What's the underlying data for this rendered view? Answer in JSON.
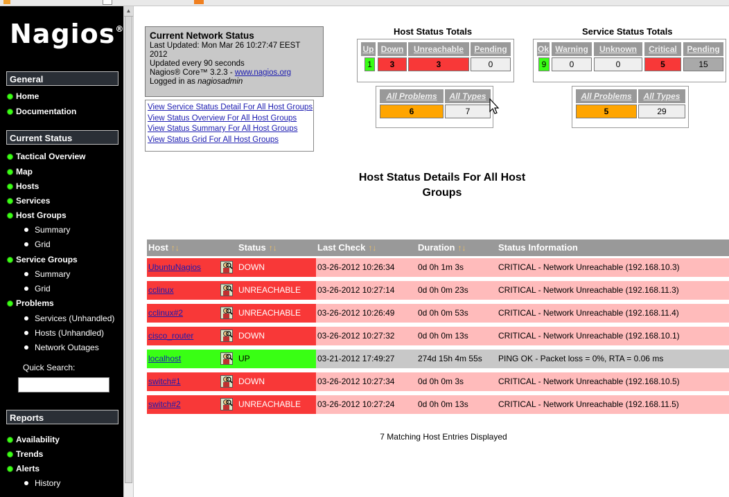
{
  "sidebar": {
    "logo": "Nagios",
    "logo_mark": "®",
    "sections": {
      "general": "General",
      "current_status": "Current Status",
      "reports": "Reports"
    },
    "general_items": [
      "Home",
      "Documentation"
    ],
    "status_items": [
      "Tactical Overview",
      "Map",
      "Hosts",
      "Services",
      "Host Groups"
    ],
    "host_group_sub": [
      "Summary",
      "Grid"
    ],
    "service_groups": "Service Groups",
    "service_group_sub": [
      "Summary",
      "Grid"
    ],
    "problems": "Problems",
    "problem_sub": [
      "Services (Unhandled)",
      "Hosts (Unhandled)",
      "Network Outages"
    ],
    "quick_search": "Quick Search:",
    "report_items": [
      "Availability",
      "Trends",
      "Alerts"
    ],
    "alert_sub": [
      "History"
    ]
  },
  "network_status": {
    "title": "Current Network Status",
    "last_updated": "Last Updated: Mon Mar 26 10:27:47 EEST 2012",
    "update_interval": "Updated every 90 seconds",
    "core_prefix": "Nagios® Core™ 3.2.3 - ",
    "core_link": "www.nagios.org",
    "logged_prefix": "Logged in as ",
    "user": "nagiosadmin"
  },
  "view_links": [
    "View Service Status Detail For All Host Groups",
    "View Status Overview For All Host Groups",
    "View Status Summary For All Host Groups",
    "View Status Grid For All Host Groups"
  ],
  "host_totals": {
    "title": "Host Status Totals",
    "headers": [
      "Up",
      "Down",
      "Unreachable",
      "Pending"
    ],
    "values": [
      "1",
      "3",
      "3",
      "0"
    ],
    "sum_headers": [
      "All Problems",
      "All Types"
    ],
    "sum_values": [
      "6",
      "7"
    ]
  },
  "service_totals": {
    "title": "Service Status Totals",
    "headers": [
      "Ok",
      "Warning",
      "Unknown",
      "Critical",
      "Pending"
    ],
    "values": [
      "9",
      "0",
      "0",
      "5",
      "15"
    ],
    "sum_headers": [
      "All Problems",
      "All Types"
    ],
    "sum_values": [
      "5",
      "29"
    ]
  },
  "main_title_line1": "Host Status Details For All Host",
  "main_title_line2": "Groups",
  "table": {
    "columns": [
      "Host",
      "Status",
      "Last Check",
      "Duration",
      "Status Information"
    ],
    "sort_arrows": "↑↓",
    "rows": [
      {
        "host": "UbuntuNagios",
        "status": "DOWN",
        "last_check": "03-26-2012 10:26:34",
        "duration": "0d 0h 1m 3s",
        "info": "CRITICAL - Network Unreachable (192.168.10.3)"
      },
      {
        "host": "cclinux",
        "status": "UNREACHABLE",
        "last_check": "03-26-2012 10:27:14",
        "duration": "0d 0h 0m 23s",
        "info": "CRITICAL - Network Unreachable (192.168.11.3)"
      },
      {
        "host": "cclinux#2",
        "status": "UNREACHABLE",
        "last_check": "03-26-2012 10:26:49",
        "duration": "0d 0h 0m 53s",
        "info": "CRITICAL - Network Unreachable (192.168.11.4)"
      },
      {
        "host": "cisco_router",
        "status": "DOWN",
        "last_check": "03-26-2012 10:27:32",
        "duration": "0d 0h 0m 13s",
        "info": "CRITICAL - Network Unreachable (192.168.10.1)"
      },
      {
        "host": "localhost",
        "status": "UP",
        "last_check": "03-21-2012 17:49:27",
        "duration": "274d 15h 4m 55s",
        "info": "PING OK - Packet loss = 0%, RTA = 0.06 ms"
      },
      {
        "host": "switch#1",
        "status": "DOWN",
        "last_check": "03-26-2012 10:27:34",
        "duration": "0d 0h 0m 3s",
        "info": "CRITICAL - Network Unreachable (192.168.10.5)"
      },
      {
        "host": "switch#2",
        "status": "UNREACHABLE",
        "last_check": "03-26-2012 10:27:24",
        "duration": "0d 0h 0m 13s",
        "info": "CRITICAL - Network Unreachable (192.168.11.5)"
      }
    ]
  },
  "matching": "7 Matching Host Entries Displayed",
  "colors": {
    "up": "#39ff14",
    "down": "#f83838",
    "problem_row": "#ffbbbb",
    "ok_row": "#c8c8c8",
    "header": "#999999",
    "problems_total": "#ffa500"
  }
}
